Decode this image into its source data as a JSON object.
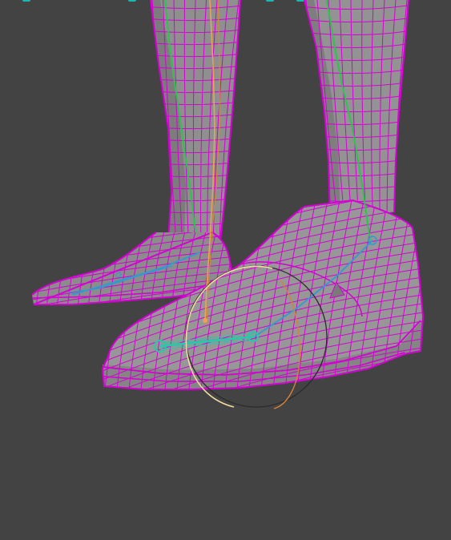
{
  "viewport": {
    "background": "#434343",
    "mesh_fill": "#8f8f8f",
    "wire_color": "#d400d4",
    "joint_color": "#26c9a8",
    "bone_color": "#2f9cd0",
    "ik_color": "#27c64a",
    "control_colors": [
      "#e8a25a",
      "#c98a3b",
      "#2a2a2a"
    ]
  },
  "icons": [
    "selection-marker-icon",
    "joint-icon",
    "control-circle-icon",
    "ik-handle-icon"
  ]
}
